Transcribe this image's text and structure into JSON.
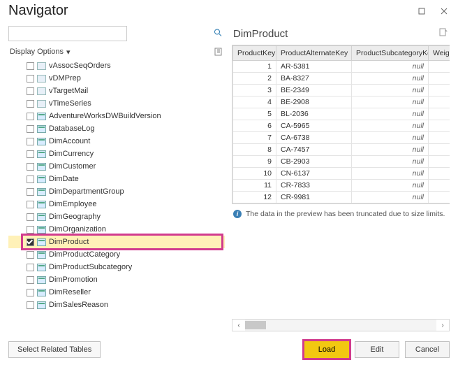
{
  "window": {
    "title": "Navigator"
  },
  "search": {
    "placeholder": ""
  },
  "display_options": {
    "label": "Display Options"
  },
  "tree": {
    "items": [
      {
        "label": "vAssocSeqOrders",
        "type": "view",
        "checked": false
      },
      {
        "label": "vDMPrep",
        "type": "view",
        "checked": false
      },
      {
        "label": "vTargetMail",
        "type": "view",
        "checked": false
      },
      {
        "label": "vTimeSeries",
        "type": "view",
        "checked": false
      },
      {
        "label": "AdventureWorksDWBuildVersion",
        "type": "table",
        "checked": false
      },
      {
        "label": "DatabaseLog",
        "type": "table",
        "checked": false
      },
      {
        "label": "DimAccount",
        "type": "table",
        "checked": false
      },
      {
        "label": "DimCurrency",
        "type": "table",
        "checked": false
      },
      {
        "label": "DimCustomer",
        "type": "table",
        "checked": false
      },
      {
        "label": "DimDate",
        "type": "table",
        "checked": false
      },
      {
        "label": "DimDepartmentGroup",
        "type": "table",
        "checked": false
      },
      {
        "label": "DimEmployee",
        "type": "table",
        "checked": false
      },
      {
        "label": "DimGeography",
        "type": "table",
        "checked": false
      },
      {
        "label": "DimOrganization",
        "type": "table",
        "checked": false
      },
      {
        "label": "DimProduct",
        "type": "table",
        "checked": true,
        "selected": true
      },
      {
        "label": "DimProductCategory",
        "type": "table",
        "checked": false
      },
      {
        "label": "DimProductSubcategory",
        "type": "table",
        "checked": false
      },
      {
        "label": "DimPromotion",
        "type": "table",
        "checked": false
      },
      {
        "label": "DimReseller",
        "type": "table",
        "checked": false
      },
      {
        "label": "DimSalesReason",
        "type": "table",
        "checked": false
      }
    ]
  },
  "preview": {
    "title": "DimProduct",
    "columns": [
      "ProductKey",
      "ProductAlternateKey",
      "ProductSubcategoryKey",
      "Weigh"
    ],
    "rows": [
      {
        "key": 1,
        "alt": "AR-5381",
        "sub": "null",
        "w": ""
      },
      {
        "key": 2,
        "alt": "BA-8327",
        "sub": "null",
        "w": ""
      },
      {
        "key": 3,
        "alt": "BE-2349",
        "sub": "null",
        "w": ""
      },
      {
        "key": 4,
        "alt": "BE-2908",
        "sub": "null",
        "w": ""
      },
      {
        "key": 5,
        "alt": "BL-2036",
        "sub": "null",
        "w": ""
      },
      {
        "key": 6,
        "alt": "CA-5965",
        "sub": "null",
        "w": ""
      },
      {
        "key": 7,
        "alt": "CA-6738",
        "sub": "null",
        "w": ""
      },
      {
        "key": 8,
        "alt": "CA-7457",
        "sub": "null",
        "w": ""
      },
      {
        "key": 9,
        "alt": "CB-2903",
        "sub": "null",
        "w": ""
      },
      {
        "key": 10,
        "alt": "CN-6137",
        "sub": "null",
        "w": ""
      },
      {
        "key": 11,
        "alt": "CR-7833",
        "sub": "null",
        "w": ""
      },
      {
        "key": 12,
        "alt": "CR-9981",
        "sub": "null",
        "w": ""
      }
    ],
    "truncate_msg": "The data in the preview has been truncated due to size limits."
  },
  "footer": {
    "select_related": "Select Related Tables",
    "load": "Load",
    "edit": "Edit",
    "cancel": "Cancel"
  }
}
